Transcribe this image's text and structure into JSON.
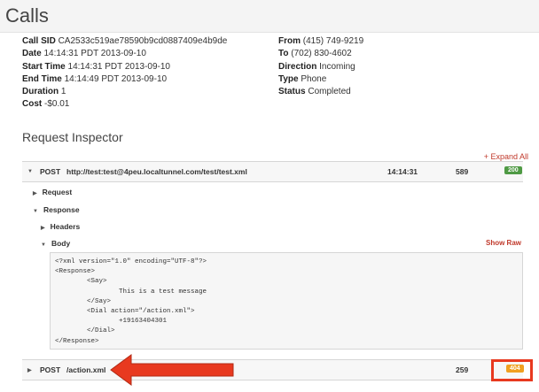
{
  "page": {
    "title": "Calls"
  },
  "call_details": {
    "left": [
      {
        "label": "Call SID",
        "value": "CA2533c519ae78590b9cd0887409e4b9de"
      },
      {
        "label": "Date",
        "value": "14:14:31 PDT 2013-09-10"
      },
      {
        "label": "Start Time",
        "value": "14:14:31 PDT 2013-09-10"
      },
      {
        "label": "End Time",
        "value": "14:14:49 PDT 2013-09-10"
      },
      {
        "label": "Duration",
        "value": "1"
      },
      {
        "label": "Cost",
        "value": "-$0.01"
      }
    ],
    "right": [
      {
        "label": "From",
        "value": "(415) 749-9219"
      },
      {
        "label": "To",
        "value": "(702) 830-4602"
      },
      {
        "label": "Direction",
        "value": "Incoming"
      },
      {
        "label": "Type",
        "value": "Phone"
      },
      {
        "label": "Status",
        "value": "Completed"
      }
    ]
  },
  "inspector": {
    "title": "Request Inspector",
    "expand_all": "+ Expand All",
    "requests": [
      {
        "method": "POST",
        "url": "http://test:test@4peu.localtunnel.com/test/test.xml",
        "time": "14:14:31",
        "duration": "589",
        "status": "200"
      },
      {
        "method": "POST",
        "url": "/action.xml",
        "time": "",
        "duration": "259",
        "status": "404"
      }
    ],
    "tree": {
      "request": "Request",
      "response": "Response",
      "headers": "Headers",
      "body": "Body"
    },
    "show_raw": "Show Raw",
    "body_xml": "<?xml version=\"1.0\" encoding=\"UTF-8\"?>\n<Response>\n        <Say>\n                This is a test message\n        </Say>\n        <Dial action=\"/action.xml\">\n                +19163404301\n        </Dial>\n</Response>"
  },
  "colors": {
    "annotation": "#e8391f",
    "badge_ok": "#4f9a44",
    "badge_err": "#f0a020"
  }
}
